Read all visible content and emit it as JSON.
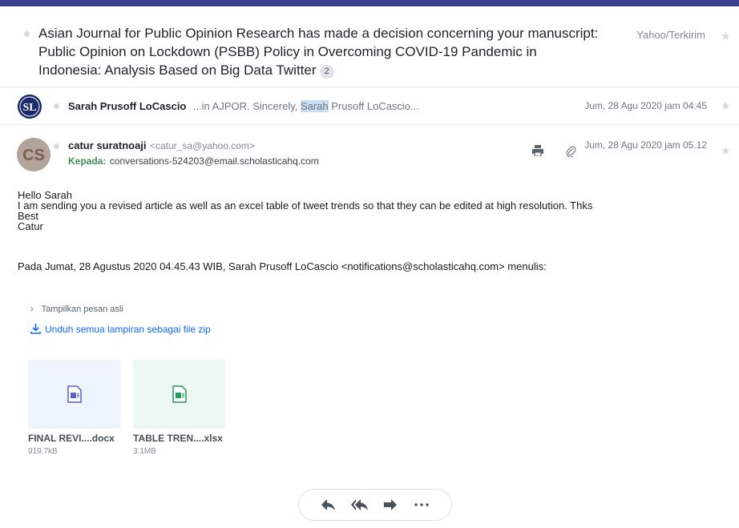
{
  "thread": {
    "subject": "Asian Journal for Public Opinion Research has made a decision concerning your manuscript: Public Opinion on Lockdown (PSBB) Policy in Overcoming COVID-19 Pandemic in Indonesia: Analysis Based on Big Data Twitter",
    "message_count": "2",
    "folder": "Yahoo/Terkirim"
  },
  "collapsed_message": {
    "sender": "Sarah Prusoff LoCascio",
    "snippet_before": "...in AJPOR. Sincerely, ",
    "snippet_highlight": "Sarah",
    "snippet_after": " Prusoff LoCascio...",
    "date": "Jum, 28 Agu 2020 jam 04.45",
    "avatar_initials": "SL"
  },
  "open_message": {
    "sender": "catur suratnoaji",
    "sender_email": "<catur_sa@yahoo.com>",
    "to_label": "Kepada:",
    "to_address": "conversations-524203@email.scholasticahq.com",
    "date": "Jum, 28 Agu 2020 jam 05.12",
    "avatar_initials": "CS",
    "body_lines": [
      "Hello Sarah",
      "I am sending you a revised article as well as an excel table of tweet trends so that they can be edited at high resolution. Thks",
      "Best",
      "Catur"
    ],
    "quote_header": "Pada Jumat, 28 Agustus 2020 04.45.43 WIB, Sarah Prusoff LoCascio <notifications@scholasticahq.com> menulis:",
    "show_original": "Tampilkan pesan asli",
    "download_all": "Unduh semua lampiran sebagai file zip",
    "attachments": [
      {
        "name": "FINAL REVI....docx",
        "size": "919.7kB",
        "type": "word",
        "color": "#5b5fc7"
      },
      {
        "name": "TABLE TREN....xlsx",
        "size": "3.1MB",
        "type": "excel",
        "color": "#1e9e5a"
      }
    ]
  },
  "icons": {
    "print": "print-icon",
    "attachment": "paperclip-icon",
    "reply": "reply-icon",
    "reply_all": "reply-all-icon",
    "forward": "forward-icon",
    "more": "more-icon"
  },
  "colors": {
    "topbar": "#3b3f8f",
    "link": "#0f69ff",
    "recipient_label": "#3f8a5c"
  }
}
